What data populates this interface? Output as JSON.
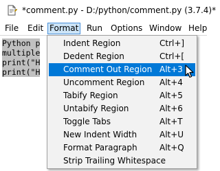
{
  "window": {
    "title": "*comment.py - D:/python/comment.py (3.7.4)*"
  },
  "menubar": {
    "items": [
      {
        "label": "File"
      },
      {
        "label": "Edit"
      },
      {
        "label": "Format",
        "active": true
      },
      {
        "label": "Run"
      },
      {
        "label": "Options"
      },
      {
        "label": "Window"
      },
      {
        "label": "Help"
      }
    ]
  },
  "editor": {
    "lines": [
      "Python p",
      "multiple",
      "print(\"H",
      "print(\"H"
    ]
  },
  "format_menu": {
    "items": [
      {
        "label": "Indent Region",
        "shortcut": "Ctrl+]"
      },
      {
        "label": "Dedent Region",
        "shortcut": "Ctrl+["
      },
      {
        "label": "Comment Out Region",
        "shortcut": "Alt+3",
        "highlighted": true
      },
      {
        "label": "Uncomment Region",
        "shortcut": "Alt+4"
      },
      {
        "label": "Tabify Region",
        "shortcut": "Alt+5"
      },
      {
        "label": "Untabify Region",
        "shortcut": "Alt+6"
      },
      {
        "label": "Toggle Tabs",
        "shortcut": "Alt+T"
      },
      {
        "label": "New Indent Width",
        "shortcut": "Alt+U"
      },
      {
        "label": "Format Paragraph",
        "shortcut": "Alt+Q"
      },
      {
        "label": "Strip Trailing Whitespace",
        "shortcut": ""
      }
    ]
  },
  "colors": {
    "highlight": "#0078d7",
    "menu_bg": "#f2f2f2",
    "selection": "#c0c0c0",
    "active_menu": "#cce4f7"
  }
}
